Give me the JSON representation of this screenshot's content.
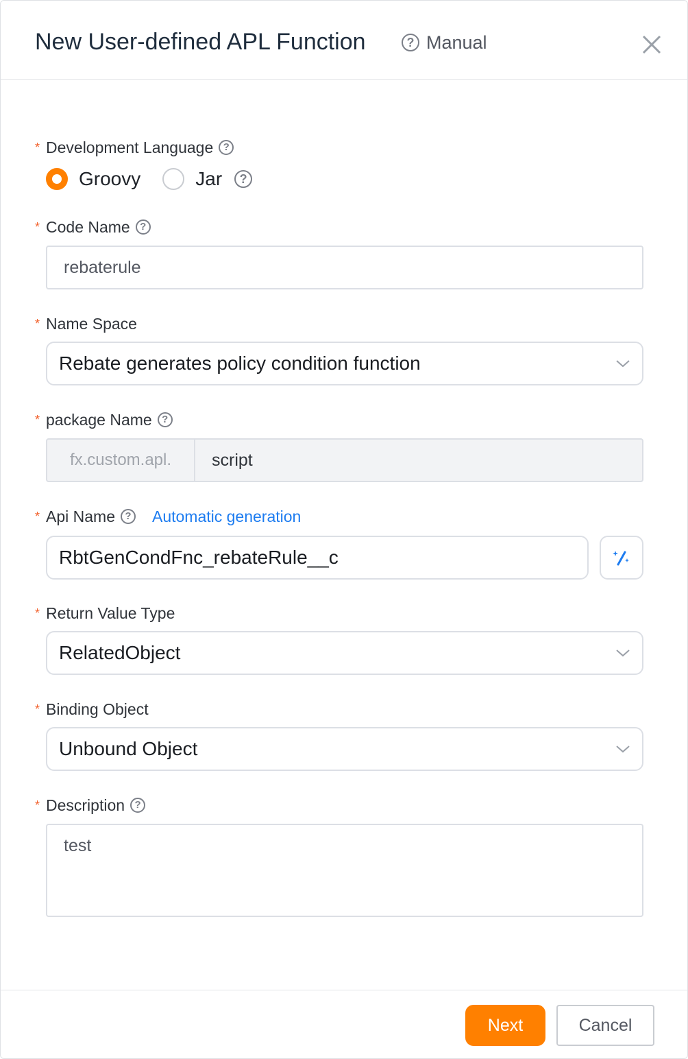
{
  "dialog": {
    "title": "New User-defined APL Function",
    "manual_label": "Manual"
  },
  "form": {
    "dev_language": {
      "label": "Development Language",
      "options": [
        "Groovy",
        "Jar"
      ],
      "selected": "Groovy"
    },
    "code_name": {
      "label": "Code Name",
      "value": "rebaterule"
    },
    "name_space": {
      "label": "Name Space",
      "value": "Rebate generates policy condition function"
    },
    "package_name": {
      "label": "package Name",
      "prefix": "fx.custom.apl.",
      "value": "script"
    },
    "api_name": {
      "label": "Api Name",
      "link": "Automatic generation",
      "value": "RbtGenCondFnc_rebateRule__c"
    },
    "return_type": {
      "label": "Return Value Type",
      "value": "RelatedObject"
    },
    "binding_object": {
      "label": "Binding Object",
      "value": "Unbound Object"
    },
    "description": {
      "label": "Description",
      "value": "test"
    },
    "required_mark": "*",
    "help_glyph": "?"
  },
  "footer": {
    "next_label": "Next",
    "cancel_label": "Cancel"
  },
  "colors": {
    "accent": "#ff8000",
    "link": "#1d7cf0",
    "required": "#f2622e"
  }
}
